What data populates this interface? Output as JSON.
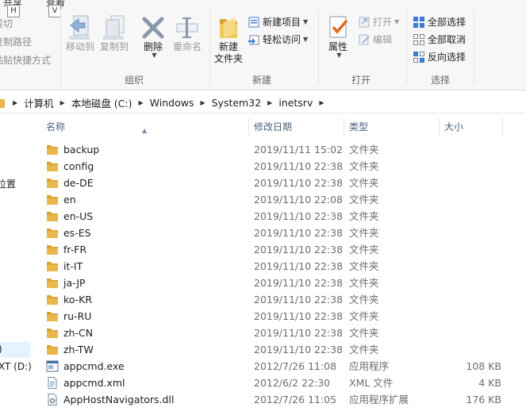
{
  "ribbon": {
    "tabs": {
      "share": "共享",
      "view": "查看",
      "share_key": "H",
      "view_key": "V"
    },
    "clipboard": {
      "cut": "剪切",
      "copy_path": "复制路径",
      "paste_shortcut": "粘贴快捷方式"
    },
    "organize": {
      "move_to": "移动到",
      "copy_to": "复制到",
      "delete": "删除",
      "rename": "重命名",
      "group_label": "组织"
    },
    "new": {
      "new_folder_line1": "新建",
      "new_folder_line2": "文件夹",
      "new_item": "新建项目",
      "easy_access": "轻松访问",
      "group_label": "新建"
    },
    "open": {
      "properties": "属性",
      "open": "打开",
      "edit": "编辑",
      "group_label": "打开"
    },
    "select": {
      "select_all": "全部选择",
      "select_none": "全部取消",
      "invert": "反向选择",
      "group_label": "选择"
    }
  },
  "address": {
    "crumbs": [
      "计算机",
      "本地磁盘 (C:)",
      "Windows",
      "System32",
      "inetsrv"
    ]
  },
  "nav": {
    "location": "位置",
    "item_paren": ")",
    "drive_d": "XT (D:)"
  },
  "columns": {
    "name": "名称",
    "date": "修改日期",
    "type": "类型",
    "size": "大小"
  },
  "files": [
    {
      "name": "backup",
      "date": "2019/11/11 15:02",
      "type": "文件夹",
      "size": "",
      "icon": "folder"
    },
    {
      "name": "config",
      "date": "2019/11/10 22:38",
      "type": "文件夹",
      "size": "",
      "icon": "folder"
    },
    {
      "name": "de-DE",
      "date": "2019/11/10 22:38",
      "type": "文件夹",
      "size": "",
      "icon": "folder"
    },
    {
      "name": "en",
      "date": "2019/11/10 22:08",
      "type": "文件夹",
      "size": "",
      "icon": "folder"
    },
    {
      "name": "en-US",
      "date": "2019/11/10 22:38",
      "type": "文件夹",
      "size": "",
      "icon": "folder"
    },
    {
      "name": "es-ES",
      "date": "2019/11/10 22:38",
      "type": "文件夹",
      "size": "",
      "icon": "folder"
    },
    {
      "name": "fr-FR",
      "date": "2019/11/10 22:38",
      "type": "文件夹",
      "size": "",
      "icon": "folder"
    },
    {
      "name": "it-IT",
      "date": "2019/11/10 22:38",
      "type": "文件夹",
      "size": "",
      "icon": "folder"
    },
    {
      "name": "ja-JP",
      "date": "2019/11/10 22:38",
      "type": "文件夹",
      "size": "",
      "icon": "folder"
    },
    {
      "name": "ko-KR",
      "date": "2019/11/10 22:38",
      "type": "文件夹",
      "size": "",
      "icon": "folder"
    },
    {
      "name": "ru-RU",
      "date": "2019/11/10 22:38",
      "type": "文件夹",
      "size": "",
      "icon": "folder"
    },
    {
      "name": "zh-CN",
      "date": "2019/11/10 22:38",
      "type": "文件夹",
      "size": "",
      "icon": "folder"
    },
    {
      "name": "zh-TW",
      "date": "2019/11/10 22:38",
      "type": "文件夹",
      "size": "",
      "icon": "folder"
    },
    {
      "name": "appcmd.exe",
      "date": "2012/7/26 11:08",
      "type": "应用程序",
      "size": "108 KB",
      "icon": "exe"
    },
    {
      "name": "appcmd.xml",
      "date": "2012/6/2 22:30",
      "type": "XML 文件",
      "size": "4 KB",
      "icon": "xml"
    },
    {
      "name": "AppHostNavigators.dll",
      "date": "2012/7/26 11:05",
      "type": "应用程序扩展",
      "size": "176 KB",
      "icon": "dll"
    }
  ],
  "colors": {
    "folder": "#e8b84a",
    "folder_dark": "#d9a22f",
    "accent": "#1f6fc5",
    "header_text": "#4c607a"
  }
}
